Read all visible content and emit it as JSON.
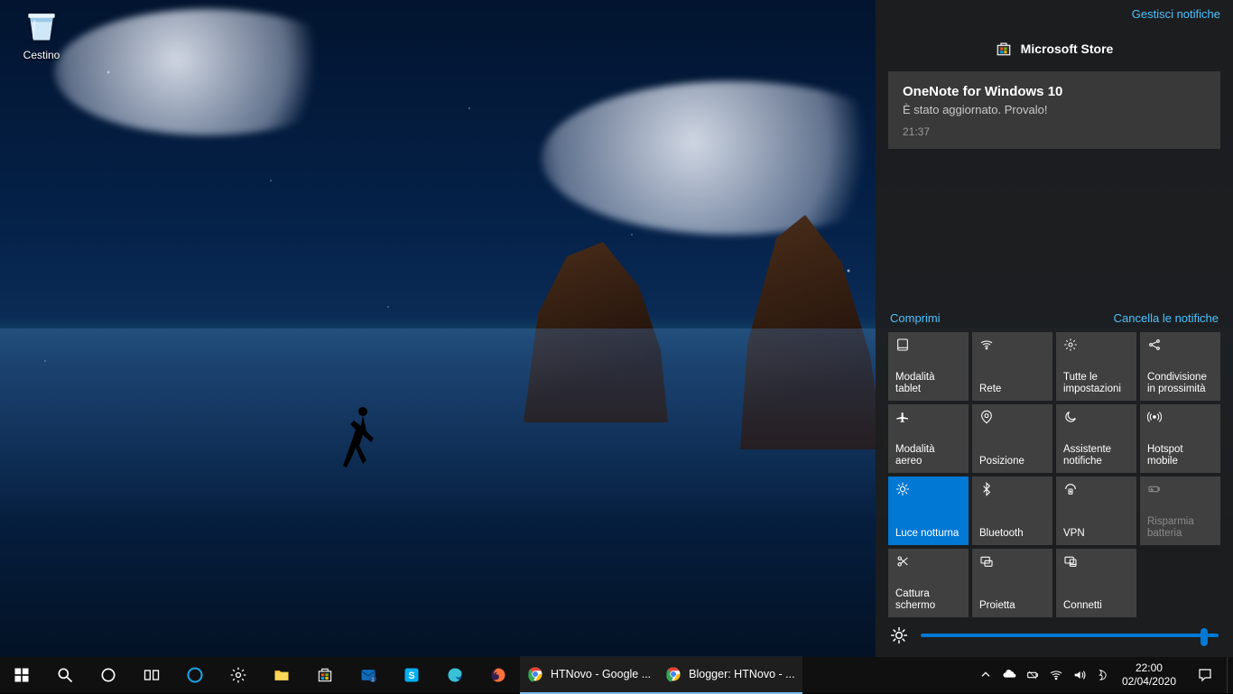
{
  "desktop": {
    "recycle_bin_label": "Cestino"
  },
  "action_center": {
    "manage_link": "Gestisci notifiche",
    "source_app": "Microsoft Store",
    "notification": {
      "title": "OneNote for Windows 10",
      "body": "È stato aggiornato. Provalo!",
      "time": "21:37"
    },
    "collapse_label": "Comprimi",
    "clear_label": "Cancella le notifiche",
    "quick_actions": [
      {
        "id": "tablet-mode",
        "label": "Modalità tablet",
        "icon": "tablet",
        "active": false,
        "disabled": false
      },
      {
        "id": "network",
        "label": "Rete",
        "icon": "wifi",
        "active": false,
        "disabled": false
      },
      {
        "id": "all-settings",
        "label": "Tutte le impostazioni",
        "icon": "gear",
        "active": false,
        "disabled": false
      },
      {
        "id": "nearby-share",
        "label": "Condivisione in prossimità",
        "icon": "share",
        "active": false,
        "disabled": false
      },
      {
        "id": "airplane-mode",
        "label": "Modalità aereo",
        "icon": "airplane",
        "active": false,
        "disabled": false
      },
      {
        "id": "location",
        "label": "Posizione",
        "icon": "location",
        "active": false,
        "disabled": false
      },
      {
        "id": "focus-assist",
        "label": "Assistente notifiche",
        "icon": "moon",
        "active": false,
        "disabled": false
      },
      {
        "id": "mobile-hotspot",
        "label": "Hotspot mobile",
        "icon": "hotspot",
        "active": false,
        "disabled": false
      },
      {
        "id": "night-light",
        "label": "Luce notturna",
        "icon": "sun",
        "active": true,
        "disabled": false
      },
      {
        "id": "bluetooth",
        "label": "Bluetooth",
        "icon": "bluetooth",
        "active": false,
        "disabled": false
      },
      {
        "id": "vpn",
        "label": "VPN",
        "icon": "vpn",
        "active": false,
        "disabled": false
      },
      {
        "id": "battery-saver",
        "label": "Risparmia batteria",
        "icon": "battery",
        "active": false,
        "disabled": true
      },
      {
        "id": "screen-snip",
        "label": "Cattura schermo",
        "icon": "snip",
        "active": false,
        "disabled": false
      },
      {
        "id": "project",
        "label": "Proietta",
        "icon": "project",
        "active": false,
        "disabled": false
      },
      {
        "id": "connect",
        "label": "Connetti",
        "icon": "connect",
        "active": false,
        "disabled": false
      }
    ],
    "brightness_percent": 95
  },
  "taskbar": {
    "running": [
      {
        "id": "chrome1",
        "label": "HTNovo - Google ...",
        "icon": "chrome"
      },
      {
        "id": "chrome2",
        "label": "Blogger: HTNovo - ...",
        "icon": "chrome"
      }
    ],
    "tray": {
      "time": "22:00",
      "date": "02/04/2020"
    }
  }
}
